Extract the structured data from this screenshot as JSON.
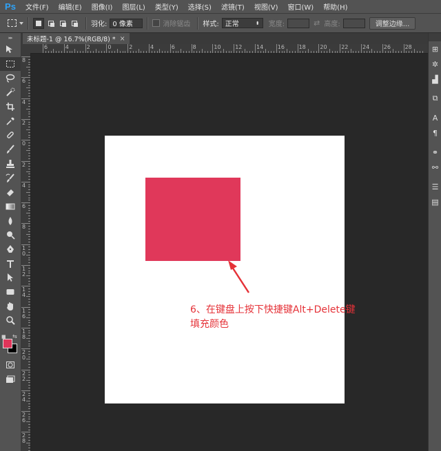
{
  "app": {
    "logo": "Ps",
    "menu": [
      "文件(F)",
      "编辑(E)",
      "图像(I)",
      "图层(L)",
      "类型(Y)",
      "选择(S)",
      "滤镜(T)",
      "视图(V)",
      "窗口(W)",
      "帮助(H)"
    ]
  },
  "options": {
    "feather_label": "羽化:",
    "feather_value": "0 像素",
    "antialias_label": "消除锯齿",
    "style_label": "样式:",
    "style_value": "正常",
    "width_label": "宽度:",
    "height_label": "高度:",
    "refine_label": "调整边缘..."
  },
  "document": {
    "tab_title": "未标题-1 @ 16.7%(RGB/8) *",
    "tab_close": "×"
  },
  "rulers": {
    "horizontal": [
      "6",
      "4",
      "2",
      "0",
      "2",
      "4",
      "6",
      "8",
      "10",
      "12",
      "14",
      "16",
      "18",
      "20",
      "22",
      "24",
      "26",
      "28"
    ],
    "vertical": [
      "8",
      "6",
      "4",
      "2",
      "0",
      "2",
      "4",
      "6",
      "8",
      "10",
      "12",
      "14",
      "16",
      "18",
      "20",
      "22",
      "24",
      "26",
      "28",
      "30"
    ]
  },
  "colors": {
    "foreground": "#e0355a",
    "background": "#000000",
    "fill": "#e0385a",
    "annotation": "#e53238"
  },
  "annotation": {
    "line1": "6、在键盘上按下快捷键Alt+Delete键",
    "line2": "填充颜色"
  },
  "tools": [
    "move-icon",
    "marquee-icon",
    "lasso-icon",
    "quick-select-icon",
    "crop-icon",
    "eyedropper-icon",
    "healing-brush-icon",
    "brush-icon",
    "clone-stamp-icon",
    "history-brush-icon",
    "eraser-icon",
    "gradient-icon",
    "blur-icon",
    "dodge-icon",
    "pen-icon",
    "type-icon",
    "path-select-icon",
    "rectangle-icon",
    "hand-icon",
    "zoom-icon"
  ]
}
